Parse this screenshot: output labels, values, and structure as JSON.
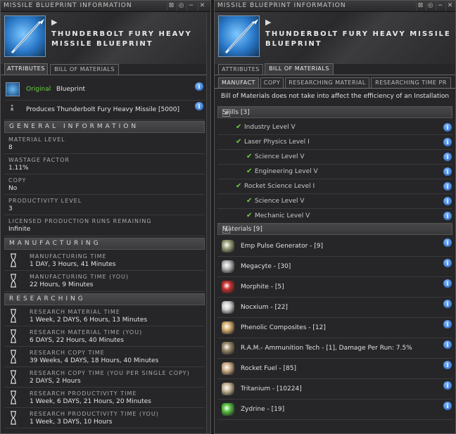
{
  "left": {
    "title": "MISSILE BLUEPRINT INFORMATION",
    "item_name": "THUNDERBOLT FURY HEAVY MISSILE BLUEPRINT",
    "tabs": [
      "ATTRIBUTES",
      "BILL OF MATERIALS"
    ],
    "original_label": "Original",
    "blueprint_label": "Blueprint",
    "produces": "Produces Thunderbolt Fury Heavy Missile [5000]",
    "general_header": "GENERAL INFORMATION",
    "general": [
      {
        "label": "MATERIAL LEVEL",
        "value": "8"
      },
      {
        "label": "WASTAGE FACTOR",
        "value": "1.11%"
      },
      {
        "label": "COPY",
        "value": "No"
      },
      {
        "label": "PRODUCTIVITY LEVEL",
        "value": "3"
      },
      {
        "label": "LICENSED PRODUCTION RUNS REMAINING",
        "value": "Infinite"
      }
    ],
    "manufacturing_header": "MANUFACTURING",
    "manufacturing": [
      {
        "label": "MANUFACTURING TIME",
        "value": "1 DAY, 3 Hours, 41 Minutes"
      },
      {
        "label": "MANUFACTURING TIME (YOU)",
        "value": "22 Hours, 9 Minutes"
      }
    ],
    "researching_header": "RESEARCHING",
    "researching": [
      {
        "label": "RESEARCH MATERIAL TIME",
        "value": "1 Week, 2 DAYS, 6 Hours, 13 Minutes"
      },
      {
        "label": "RESEARCH MATERIAL TIME (YOU)",
        "value": "6 DAYS, 22 Hours, 40 Minutes"
      },
      {
        "label": "RESEARCH COPY TIME",
        "value": "39 Weeks, 4 DAYS, 18 Hours, 40 Minutes"
      },
      {
        "label": "RESEARCH COPY TIME (YOU PER SINGLE COPY)",
        "value": "2 DAYS, 2 Hours"
      },
      {
        "label": "RESEARCH PRODUCTIVITY TIME",
        "value": "1 Week, 6 DAYS, 21 Hours, 20 Minutes"
      },
      {
        "label": "RESEARCH PRODUCTIVITY TIME (YOU)",
        "value": "1 Week, 3 DAYS, 10 Hours"
      }
    ]
  },
  "right": {
    "title": "MISSILE BLUEPRINT INFORMATION",
    "item_name": "THUNDERBOLT FURY HEAVY MISSILE BLUEPRINT",
    "tabs": [
      "ATTRIBUTES",
      "BILL OF MATERIALS"
    ],
    "subtabs": [
      "MANUFACT",
      "COPY",
      "RESEARCHING MATERIAL",
      "RESEARCHING TIME PR"
    ],
    "notice": "Bill of Materials does not take into affect the efficiency of an Installation",
    "skills_header": "Skills [3]",
    "skills": [
      {
        "name": "Industry Level V",
        "level": 0
      },
      {
        "name": "Laser Physics Level I",
        "level": 0
      },
      {
        "name": "Science Level V",
        "level": 1
      },
      {
        "name": "Engineering Level V",
        "level": 1
      },
      {
        "name": "Rocket Science Level I",
        "level": 0
      },
      {
        "name": "Science Level V",
        "level": 1
      },
      {
        "name": "Mechanic Level V",
        "level": 1
      }
    ],
    "materials_header": "Materials [9]",
    "materials": [
      {
        "name": "Emp Pulse Generator - [9]",
        "icon": "emp-pulse-generator-icon",
        "color": "#9aa27a"
      },
      {
        "name": "Megacyte - [30]",
        "icon": "megacyte-icon",
        "color": "#b8b8b8"
      },
      {
        "name": "Morphite - [5]",
        "icon": "morphite-icon",
        "color": "#c83030"
      },
      {
        "name": "Nocxium - [22]",
        "icon": "nocxium-icon",
        "color": "#d0d0d0"
      },
      {
        "name": "Phenolic Composites - [12]",
        "icon": "phenolic-composites-icon",
        "color": "#d8b070"
      },
      {
        "name": "R.A.M.- Ammunition Tech - [1], Damage Per Run: 7.5%",
        "icon": "ram-ammunition-tech-icon",
        "color": "#9a8a6a"
      },
      {
        "name": "Rocket Fuel - [85]",
        "icon": "rocket-fuel-icon",
        "color": "#d0b088"
      },
      {
        "name": "Tritanium - [10224]",
        "icon": "tritanium-icon",
        "color": "#c8b898"
      },
      {
        "name": "Zydrine - [19]",
        "icon": "zydrine-icon",
        "color": "#58c040"
      }
    ]
  },
  "buttons": {
    "pin": "⊠",
    "min": "−",
    "close": "✕",
    "opts": "◎"
  },
  "info_glyph": "i",
  "check_glyph": "✔",
  "collapse_glyph": "⩓"
}
